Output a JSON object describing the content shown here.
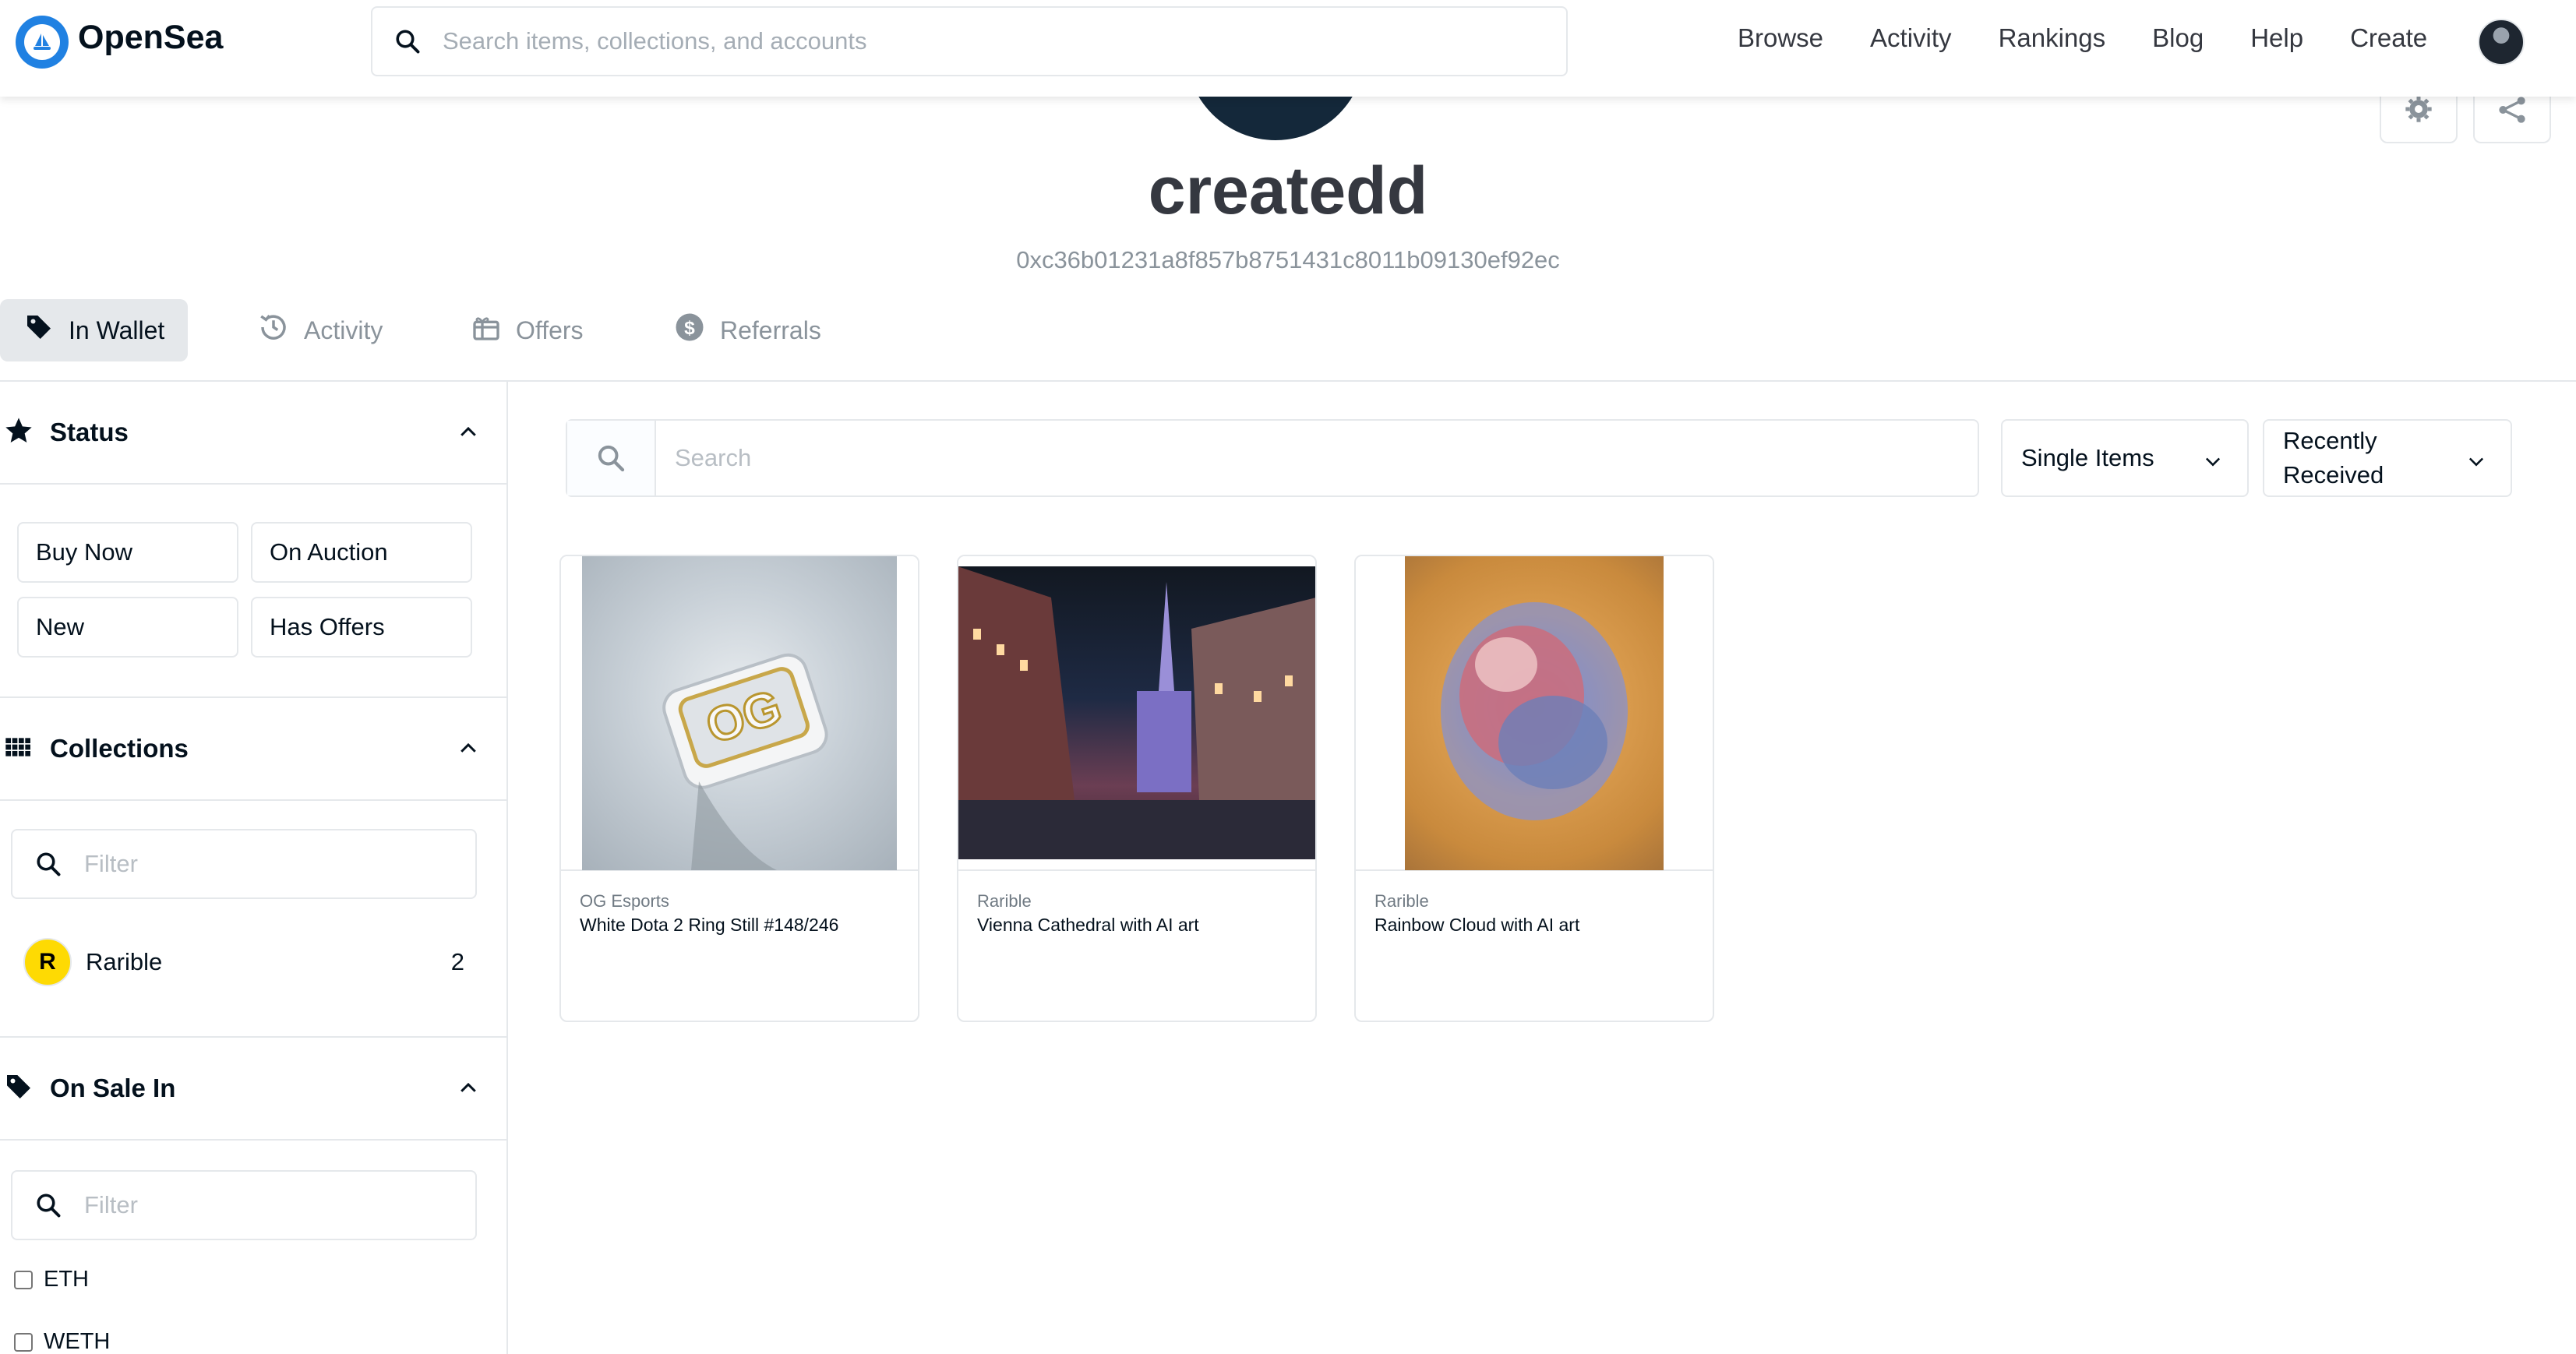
{
  "nav": {
    "brand": "OpenSea",
    "search_placeholder": "Search items, collections, and accounts",
    "links": [
      "Browse",
      "Activity",
      "Rankings",
      "Blog",
      "Help",
      "Create"
    ]
  },
  "profile": {
    "username": "createdd",
    "address": "0xc36b01231a8f857b8751431c8011b09130ef92ec"
  },
  "tabs": [
    {
      "label": "In Wallet",
      "icon": "tag-icon"
    },
    {
      "label": "Activity",
      "icon": "history-icon"
    },
    {
      "label": "Offers",
      "icon": "gift-icon"
    },
    {
      "label": "Referrals",
      "icon": "dollar-icon"
    }
  ],
  "sidebar": {
    "status": {
      "title": "Status",
      "buttons": [
        "Buy Now",
        "On Auction",
        "New",
        "Has Offers"
      ]
    },
    "collections": {
      "title": "Collections",
      "filter_placeholder": "Filter",
      "items": [
        {
          "name": "Rarible",
          "count": "2",
          "logo_letter": "R"
        }
      ]
    },
    "on_sale_in": {
      "title": "On Sale In",
      "filter_placeholder": "Filter",
      "options": [
        "ETH",
        "WETH"
      ]
    }
  },
  "main": {
    "search_placeholder": "Search",
    "item_type_select": "Single Items",
    "sort_select": [
      "Recently",
      "Received"
    ]
  },
  "cards": [
    {
      "collection": "OG Esports",
      "name": "White Dota 2 Ring Still #148/246"
    },
    {
      "collection": "Rarible",
      "name": "Vienna Cathedral with AI art"
    },
    {
      "collection": "Rarible",
      "name": "Rainbow Cloud with AI art"
    }
  ],
  "colors": {
    "accent": "#2081e2",
    "border": "#e5e8eb",
    "muted": "#8a939b",
    "rarible": "#feda03"
  }
}
